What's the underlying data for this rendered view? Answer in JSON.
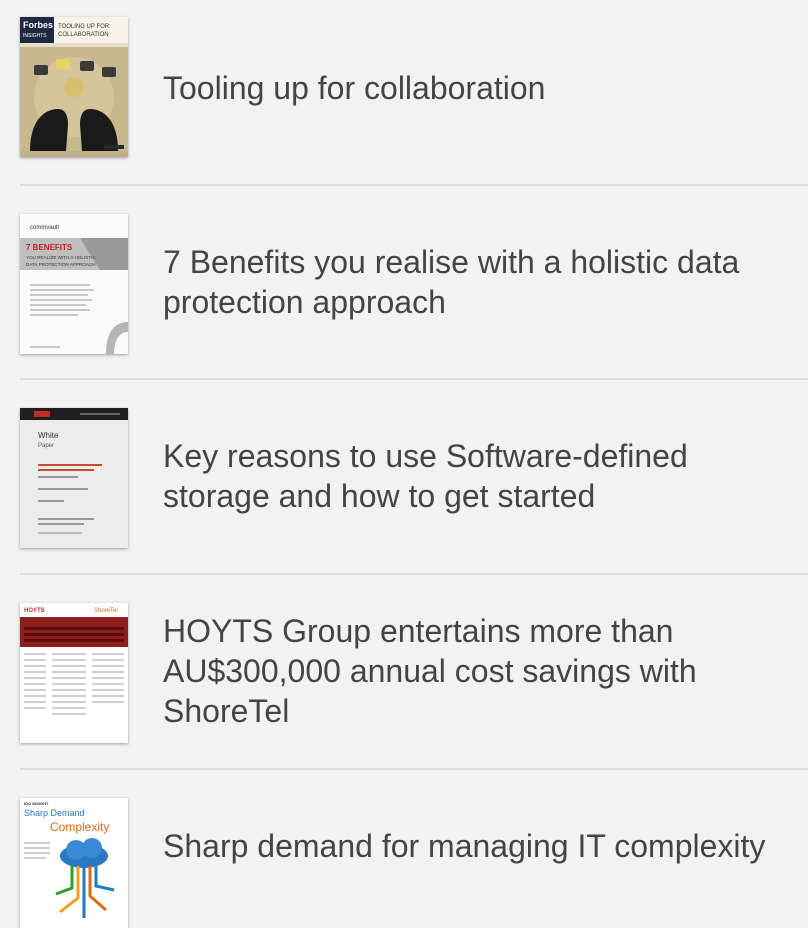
{
  "articles": [
    {
      "title": "Tooling up for collaboration",
      "cover": {
        "brand_line1": "Forbes",
        "brand_line2": "INSIGHTS",
        "headline_line1": "TOOLING UP FOR",
        "headline_line2": "COLLABORATION",
        "icon": "collaboration-cover-icon"
      }
    },
    {
      "title": "7 Benefits you realise with a holistic data protection approach",
      "cover": {
        "brand": "commvault",
        "headline_line1": "7 BENEFITS",
        "headline_line2": "YOU REALIZE WITH A HOLISTIC",
        "headline_line3": "DATA PROTECTION APPROACH",
        "icon": "data-protection-cover-icon"
      }
    },
    {
      "title": "Key reasons to use Software-defined storage and how to get started",
      "cover": {
        "label_line1": "White",
        "label_line2": "Paper",
        "icon": "white-paper-cover-icon"
      }
    },
    {
      "title": "HOYTS Group entertains more than AU$300,000 annual cost savings with ShoreTel",
      "cover": {
        "brand_left": "HOYTS",
        "brand_right": "ShoreTel",
        "icon": "case-study-cover-icon"
      }
    },
    {
      "title": "Sharp demand for managing IT complexity",
      "cover": {
        "brand": "IDG INSIGHT",
        "headline_line1": "Sharp Demand",
        "headline_line2": "Complexity",
        "icon": "it-complexity-cover-icon"
      }
    }
  ]
}
